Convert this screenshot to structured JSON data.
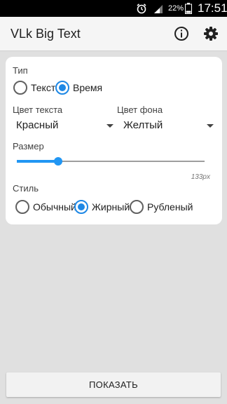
{
  "status_bar": {
    "battery_percent": "22%",
    "time": "17:51",
    "icons": [
      "alarm-icon",
      "signal-icon",
      "battery-icon"
    ]
  },
  "app_bar": {
    "title": "VLk Big Text",
    "icons": [
      "info-icon",
      "gear-icon"
    ]
  },
  "settings": {
    "type": {
      "label": "Тип",
      "options": [
        {
          "label": "Текст",
          "selected": false
        },
        {
          "label": "Время",
          "selected": true
        }
      ]
    },
    "text_color": {
      "label": "Цвет текста",
      "value": "Красный"
    },
    "background_color": {
      "label": "Цвет фона",
      "value": "Желтый"
    },
    "size": {
      "label": "Размер",
      "value_text": "133px",
      "slider_fraction": 0.22
    },
    "style": {
      "label": "Стиль",
      "options": [
        {
          "label": "Обычный",
          "selected": false
        },
        {
          "label": "Жирный",
          "selected": true
        },
        {
          "label": "Рубленый",
          "selected": false
        }
      ]
    }
  },
  "show_button": {
    "label": "ПОКАЗАТЬ"
  },
  "colors": {
    "accent": "#2196f3",
    "app_bar": "#f5f5f5",
    "background": "#e0e0e0",
    "card": "#ffffff",
    "status_bar": "#000000"
  }
}
